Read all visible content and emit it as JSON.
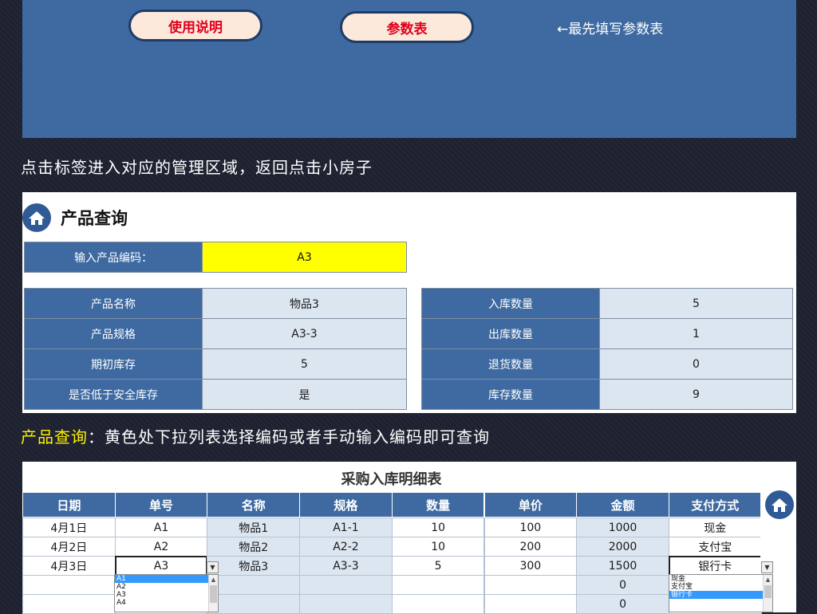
{
  "banner": {
    "help_button": "使用说明",
    "params_button": "参数表",
    "params_hint": "←最先填写参数表"
  },
  "caption1": "点击标签进入对应的管理区域，返回点击小房子",
  "query": {
    "title": "产品查询",
    "input_label": "输入产品编码：",
    "input_value": "A3",
    "left_rows": [
      {
        "label": "产品名称",
        "value": "物品3"
      },
      {
        "label": "产品规格",
        "value": "A3-3"
      },
      {
        "label": "期初库存",
        "value": "5"
      },
      {
        "label": "是否低于安全库存",
        "value": "是"
      }
    ],
    "right_rows": [
      {
        "label": "入库数量",
        "value": "5"
      },
      {
        "label": "出库数量",
        "value": "1"
      },
      {
        "label": "退货数量",
        "value": "0"
      },
      {
        "label": "库存数量",
        "value": "9"
      }
    ]
  },
  "caption2": {
    "highlight": "产品查询",
    "rest": "：黄色处下拉列表选择编码或者手动输入编码即可查询"
  },
  "purchase": {
    "title": "采购入库明细表",
    "headers": [
      "日期",
      "单号",
      "名称",
      "规格",
      "数量",
      "单价",
      "金额",
      "支付方式"
    ],
    "rows": [
      [
        "4月1日",
        "A1",
        "物品1",
        "A1-1",
        "10",
        "100",
        "1000",
        "现金"
      ],
      [
        "4月2日",
        "A2",
        "物品2",
        "A2-2",
        "10",
        "200",
        "2000",
        "支付宝"
      ],
      [
        "4月3日",
        "A3",
        "物品3",
        "A3-3",
        "5",
        "300",
        "1500",
        "银行卡"
      ],
      [
        "",
        "",
        "",
        "",
        "",
        "",
        "0",
        ""
      ],
      [
        "",
        "",
        "",
        "",
        "",
        "",
        "0",
        ""
      ]
    ]
  },
  "code_dropdown": {
    "options": [
      "A1",
      "A2",
      "A3",
      "A4"
    ],
    "selected_index": 0
  },
  "pay_dropdown": {
    "options": [
      "现金",
      "支付宝",
      "银行卡"
    ],
    "selected_index": 2
  },
  "icons": {
    "home": "home-icon",
    "dropdown": "chevron-down-icon"
  },
  "colors": {
    "banner": "#3e6aa1",
    "header": "#3e6aa1",
    "highlight": "#ffff00",
    "caption_highlight": "#fff200",
    "button_text": "#e0001b"
  }
}
